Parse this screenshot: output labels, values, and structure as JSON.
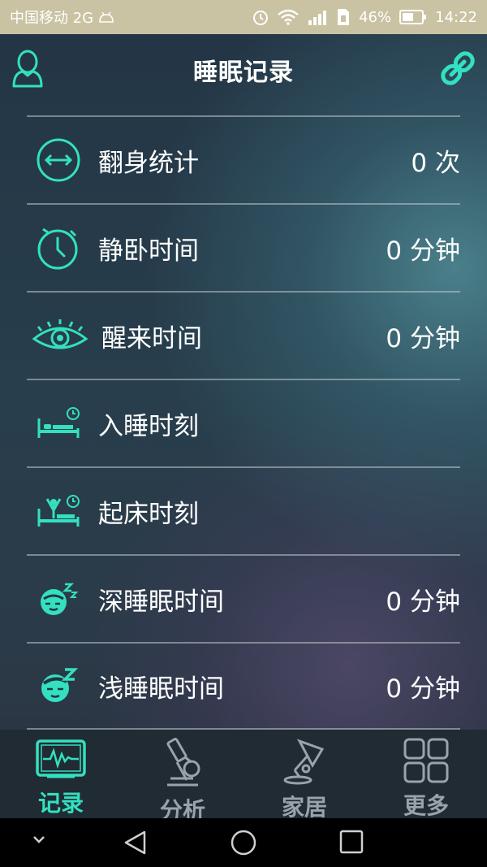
{
  "status_bar": {
    "carrier": "中国移动 2G",
    "battery": "46%",
    "time": "14:22"
  },
  "header": {
    "title": "睡眠记录",
    "left_icon": "user-icon",
    "right_icon": "link-icon"
  },
  "rows": [
    {
      "icon": "turn-over-icon",
      "label": "翻身统计",
      "value": "0 次"
    },
    {
      "icon": "stopwatch-icon",
      "label": "静卧时间",
      "value": "0 分钟"
    },
    {
      "icon": "eye-icon",
      "label": "醒来时间",
      "value": "0 分钟"
    },
    {
      "icon": "bed-clock-icon",
      "label": "入睡时刻",
      "value": ""
    },
    {
      "icon": "wake-up-icon",
      "label": "起床时刻",
      "value": ""
    },
    {
      "icon": "deep-sleep-face-icon",
      "label": "深睡眠时间",
      "value": "0 分钟"
    },
    {
      "icon": "light-sleep-face-icon",
      "label": "浅睡眠时间",
      "value": "0 分钟"
    }
  ],
  "tabs": [
    {
      "icon": "monitor-icon",
      "label": "记录",
      "active": true
    },
    {
      "icon": "microscope-icon",
      "label": "分析",
      "active": false
    },
    {
      "icon": "lamp-icon",
      "label": "家居",
      "active": false
    },
    {
      "icon": "grid-icon",
      "label": "更多",
      "active": false
    }
  ],
  "colors": {
    "accent": "#33e0c0",
    "status_bar": "#c9c3a3",
    "tab_inactive": "#9aa3aa"
  }
}
